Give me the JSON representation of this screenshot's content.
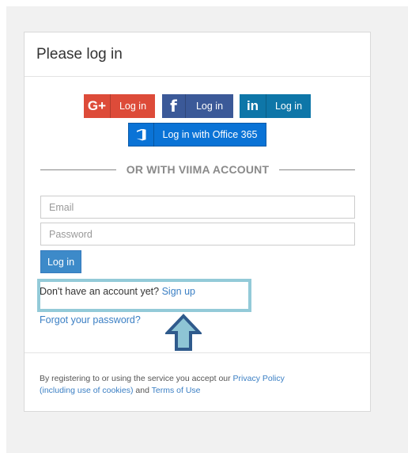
{
  "panel": {
    "title": "Please log in"
  },
  "social": {
    "google": {
      "icon_text": "G+",
      "label": "Log in"
    },
    "facebook": {
      "icon_text": "f",
      "label": "Log in"
    },
    "linkedin": {
      "icon_text": "in",
      "label": "Log in"
    },
    "office": {
      "label": "Log in with Office 365"
    }
  },
  "divider": {
    "text": "OR WITH VIIMA ACCOUNT"
  },
  "form": {
    "email_placeholder": "Email",
    "password_placeholder": "Password",
    "login_label": "Log in"
  },
  "signup": {
    "prompt": "Don't have an account yet? ",
    "link": "Sign up"
  },
  "forgot": {
    "link": "Forgot your password?"
  },
  "footer": {
    "text1": "By registering to or using the service you accept our ",
    "privacy_link": "Privacy Policy",
    "cookies_link": "(including use of cookies)",
    "and_text": " and ",
    "terms_link": "Terms of Use"
  },
  "colors": {
    "google": "#dd4b39",
    "facebook": "#3b5998",
    "linkedin": "#0e76a8",
    "office": "#0a73d6",
    "primary": "#3d8ac9",
    "link": "#3b7fc4",
    "highlight": "#93cad8",
    "arrow_fill": "#8ec5d5",
    "arrow_stroke": "#2f5a8c"
  },
  "icons": {
    "google": "google-plus-icon",
    "facebook": "facebook-icon",
    "linkedin": "linkedin-icon",
    "office": "office-365-icon",
    "arrow": "up-arrow-icon"
  }
}
